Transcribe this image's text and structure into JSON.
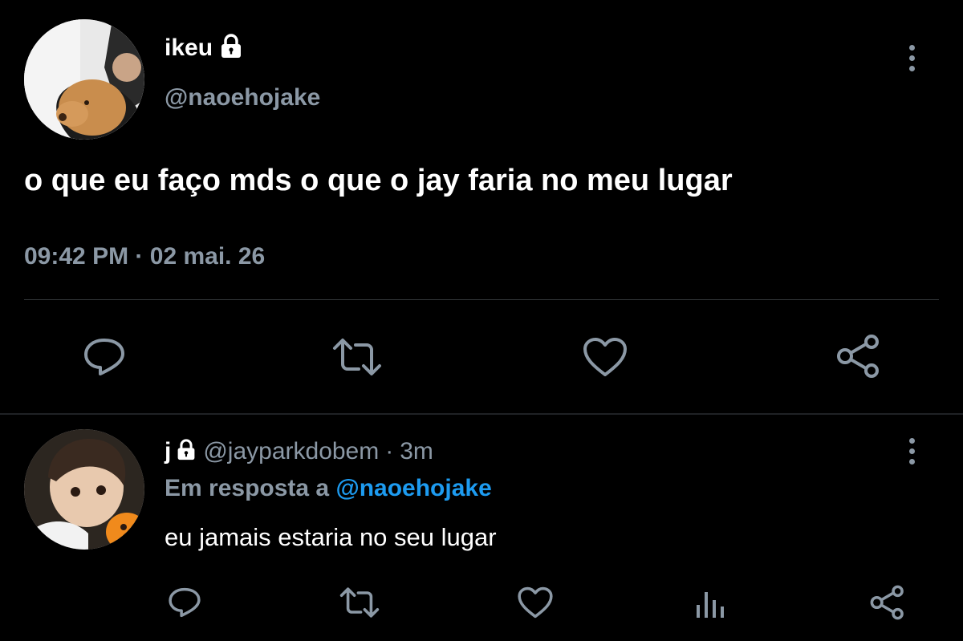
{
  "tweet": {
    "author_name": "ikeu",
    "author_handle": "@naoehojake",
    "text": "o que eu faço mds o que o jay faria no meu lugar",
    "time": "09:42 PM",
    "dot": "·",
    "date": "02 mai. 26",
    "actions": [
      "reply-icon",
      "retweet-icon",
      "like-icon",
      "share-icon"
    ]
  },
  "reply": {
    "author_name": "j",
    "author_handle": "@jayparkdobem",
    "dot": "·",
    "age": "3m",
    "reply_prefix": "Em resposta a",
    "reply_to": "@naoehojake",
    "text": "eu jamais estaria no seu lugar",
    "actions": [
      "reply-icon",
      "retweet-icon",
      "like-icon",
      "analytics-icon",
      "share-icon"
    ]
  },
  "colors": {
    "background": "#000000",
    "text": "#ffffff",
    "muted": "#8b98a5",
    "link": "#1d9bf0",
    "divider": "#2f3336"
  }
}
